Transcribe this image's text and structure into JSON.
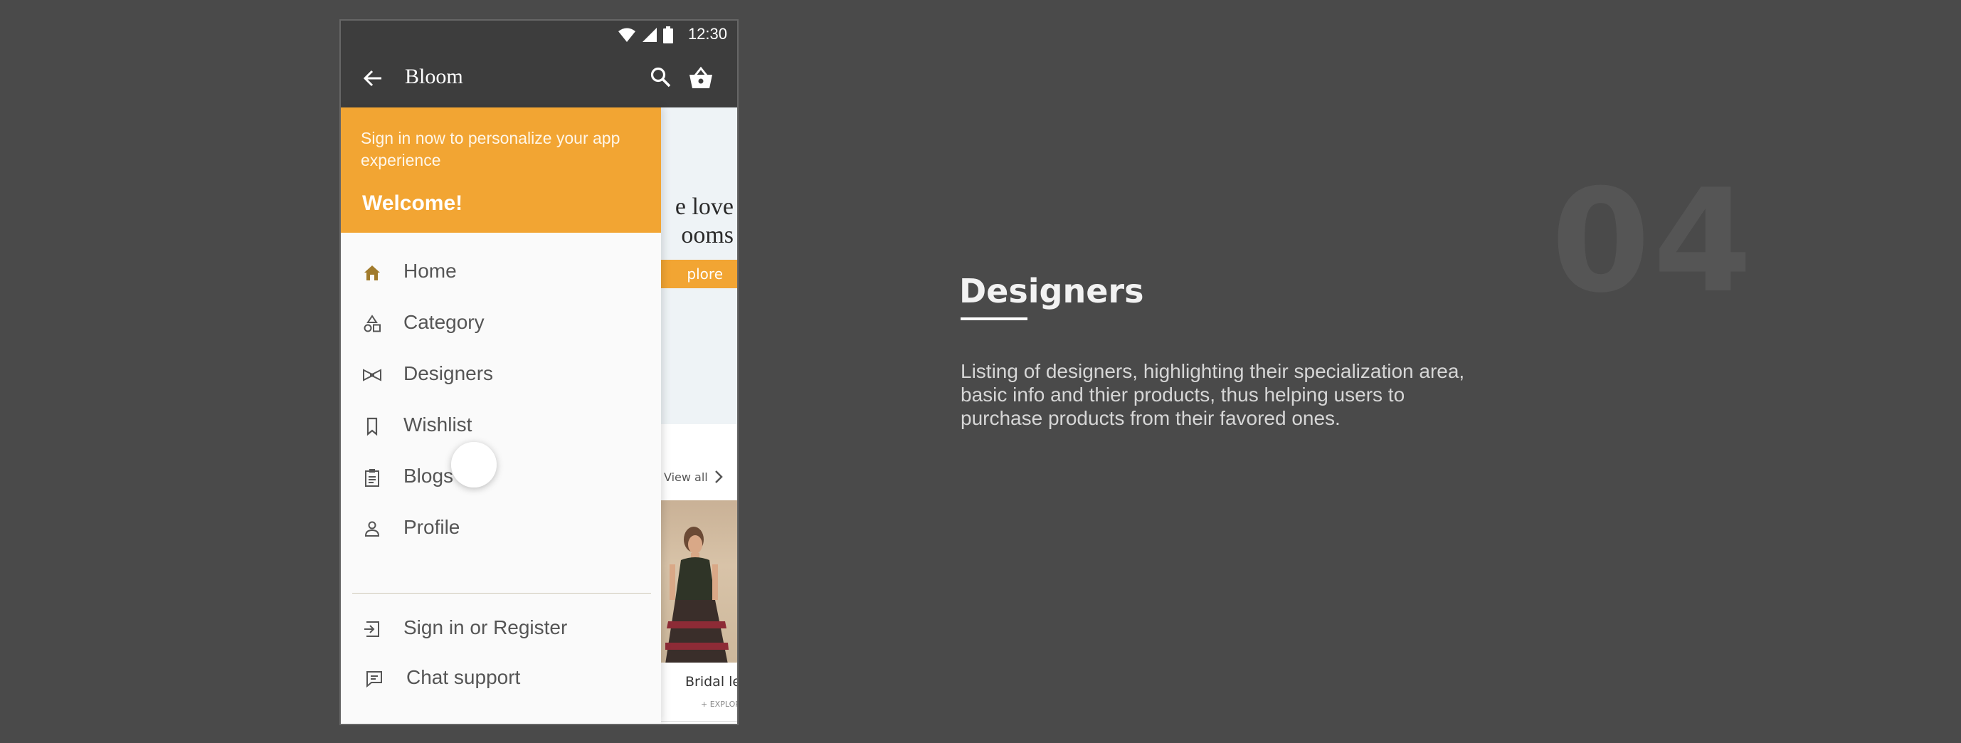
{
  "status_bar": {
    "time": "12:30",
    "icons": [
      "wifi-icon",
      "signal-icon",
      "battery-icon"
    ]
  },
  "app_bar": {
    "title": "Bloom",
    "icons": [
      "back-arrow-icon",
      "search-icon",
      "basket-icon"
    ]
  },
  "drawer": {
    "signin_prompt": "Sign in now to personalize your app experience",
    "welcome": "Welcome!",
    "items": [
      {
        "label": "Home",
        "icon": "home-icon"
      },
      {
        "label": "Category",
        "icon": "category-icon"
      },
      {
        "label": "Designers",
        "icon": "bowtie-icon"
      },
      {
        "label": "Wishlist",
        "icon": "bookmark-icon"
      },
      {
        "label": "Blogs",
        "icon": "clipboard-icon"
      },
      {
        "label": "Profile",
        "icon": "person-icon"
      }
    ],
    "footer_items": [
      {
        "label": "Sign in or Register",
        "icon": "login-icon"
      },
      {
        "label": "Chat support",
        "icon": "chat-icon"
      }
    ]
  },
  "background_content": {
    "hero_text_line1": "e love",
    "hero_text_line2": "ooms",
    "hero_button": "plore",
    "view_all": "View all",
    "product_name": "Bridal le",
    "product_explore": "+ EXPLOR"
  },
  "slide": {
    "number": "04",
    "title": "Designers",
    "description": "Listing of designers, highlighting their specialization area, basic info and thier products, thus helping users to purchase products from their favored ones."
  },
  "colors": {
    "accent": "#f2a533",
    "background": "#4a4a4a",
    "app_bar": "#3d3d3d"
  }
}
